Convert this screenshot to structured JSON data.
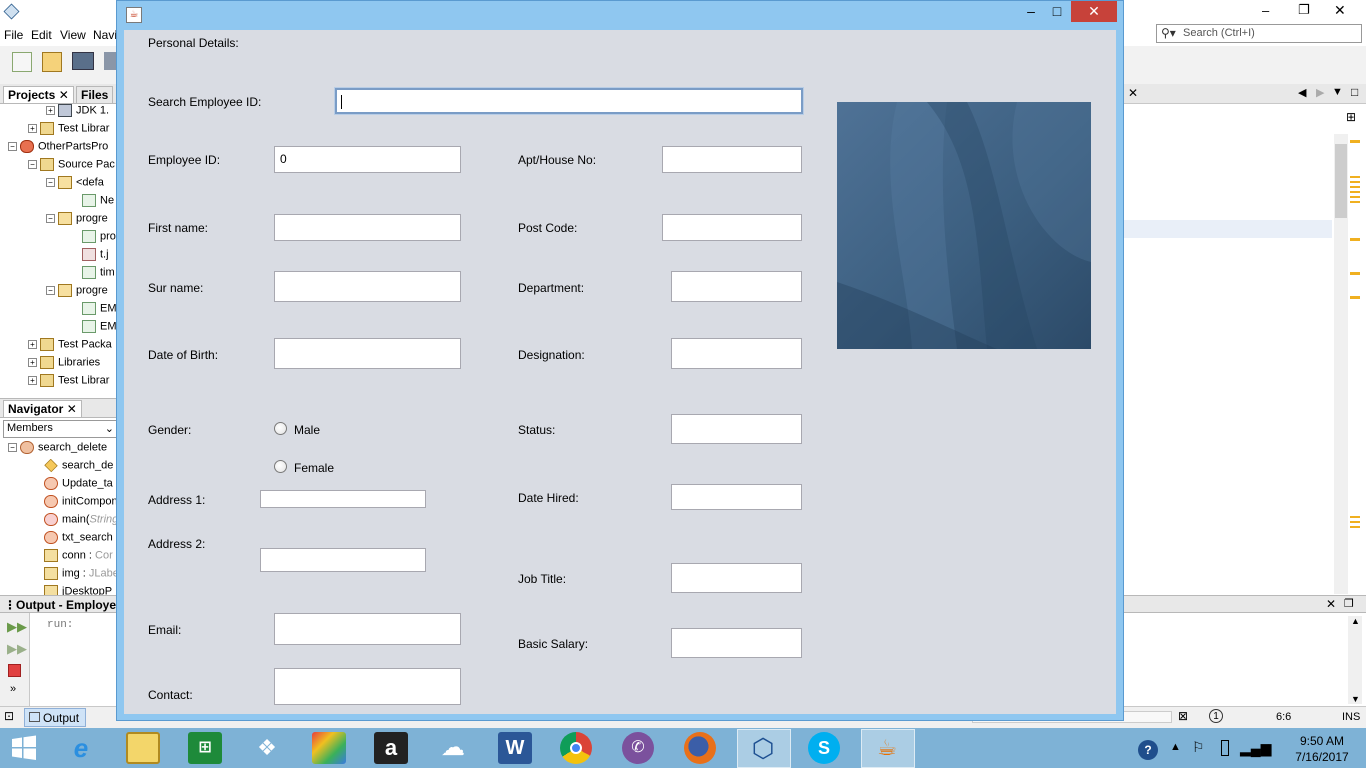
{
  "ide": {
    "menu": [
      "File",
      "Edit",
      "View",
      "Navi"
    ],
    "search_placeholder": "Search (Ctrl+I)",
    "tabs": {
      "projects": "Projects",
      "files": "Files"
    },
    "project_tree": [
      "JDK 1.",
      "Test Librar",
      "OtherPartsPro",
      "Source Pac",
      "<defa",
      "Ne",
      "progre",
      "pro",
      "t.j",
      "tim",
      "progre",
      "EM",
      "EM",
      "Test Packa",
      "Libraries",
      "Test Librar"
    ],
    "navigator": {
      "title": "Navigator",
      "members": "Members"
    },
    "navigator_items": [
      {
        "name": "search_delete",
        "type": ""
      },
      {
        "name": "search_de",
        "type": ""
      },
      {
        "name": "Update_ta",
        "type": ""
      },
      {
        "name": "initCompon",
        "type": ""
      },
      {
        "name": "main(",
        "type": "String"
      },
      {
        "name": "txt_search",
        "type": ""
      },
      {
        "name": "conn : ",
        "type": "Cor"
      },
      {
        "name": "img : ",
        "type": "JLabe"
      },
      {
        "name": "jDesktopP",
        "type": ""
      }
    ],
    "output": {
      "title": "Output - Employee",
      "text": "run:"
    },
    "status": {
      "output_tab": "Output",
      "position": "6:6",
      "mode": "INS"
    }
  },
  "dialog": {
    "section_title": "Personal Details:",
    "search_label": "Search Employee ID:",
    "search_value": "",
    "left_fields": {
      "employee_id": {
        "label": "Employee ID:",
        "value": "0"
      },
      "first_name": {
        "label": "First name:",
        "value": ""
      },
      "sur_name": {
        "label": "Sur name:",
        "value": ""
      },
      "dob": {
        "label": "Date of Birth:",
        "value": ""
      },
      "gender": {
        "label": "Gender:",
        "male": "Male",
        "female": "Female"
      },
      "address1": {
        "label": "Address 1:",
        "value": ""
      },
      "address2": {
        "label": "Address 2:",
        "value": ""
      },
      "email": {
        "label": "Email:",
        "value": ""
      },
      "contact": {
        "label": "Contact:",
        "value": ""
      }
    },
    "right_fields": {
      "apt": {
        "label": "Apt/House No:",
        "value": ""
      },
      "post_code": {
        "label": "Post Code:",
        "value": ""
      },
      "department": {
        "label": "Department:",
        "value": ""
      },
      "designation": {
        "label": "Designation:",
        "value": ""
      },
      "status": {
        "label": "Status:",
        "value": ""
      },
      "date_hired": {
        "label": "Date Hired:",
        "value": ""
      },
      "job_title": {
        "label": "Job Title:",
        "value": ""
      },
      "basic_salary": {
        "label": "Basic Salary:",
        "value": ""
      }
    },
    "window_buttons": {
      "minimize": "–",
      "maximize": "□",
      "close": "✕"
    }
  },
  "taskbar": {
    "apps": [
      "start",
      "internet-explorer",
      "file-explorer",
      "store",
      "dropbox",
      "puzzle",
      "amazon",
      "onedrive",
      "word",
      "chrome",
      "viber",
      "firefox",
      "virtualbox",
      "skype",
      "java"
    ],
    "word_letter": "W",
    "amazon_letter": "a",
    "time": "9:50 AM",
    "date": "7/16/2017"
  },
  "colors": {
    "dialog_frame": "#8fc7f0",
    "dialog_bg": "#d9dce3",
    "close_button": "#c7423a",
    "taskbar": "#7eb2d6"
  }
}
